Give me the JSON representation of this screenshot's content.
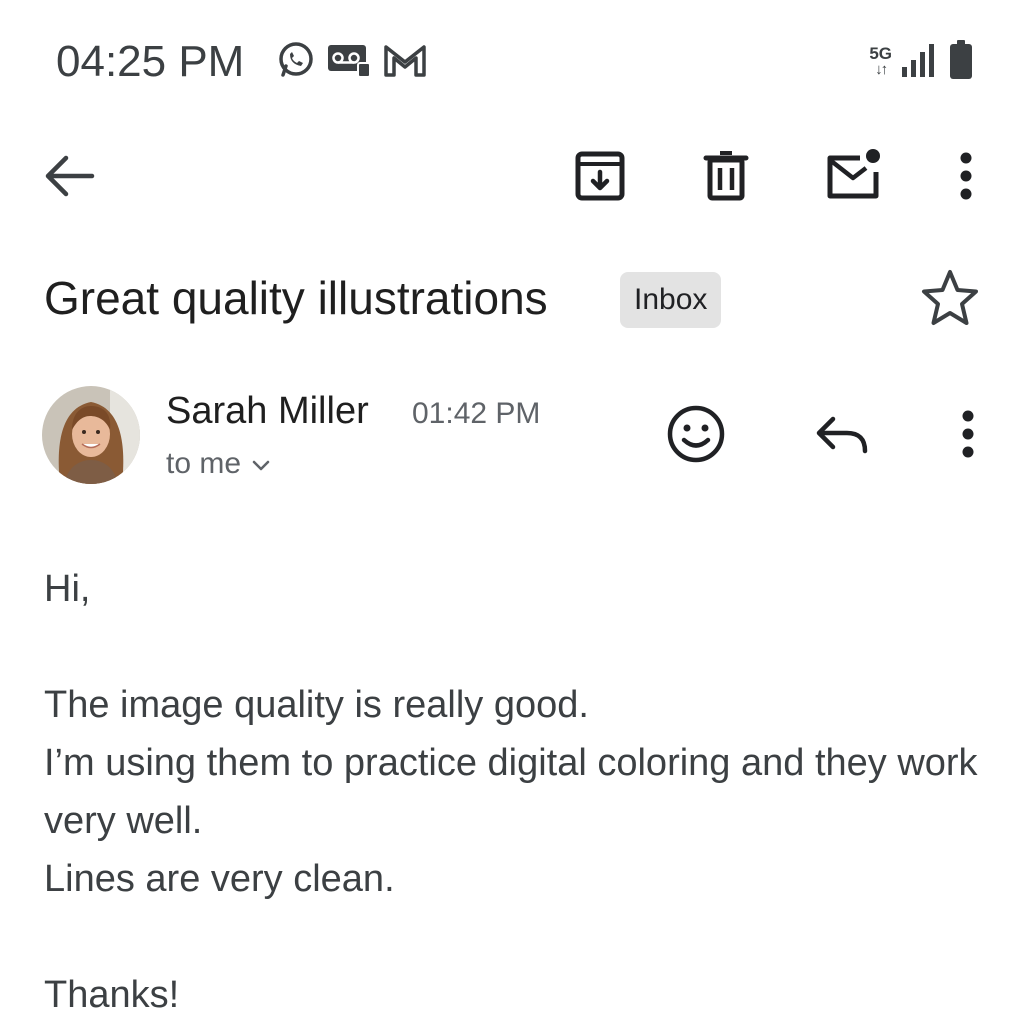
{
  "status_bar": {
    "time": "04:25 PM",
    "network": "5G",
    "network_arrows": "↓↑",
    "notification_icons": [
      "whatsapp-icon",
      "voicemail-icon",
      "gmail-icon"
    ]
  },
  "toolbar": {
    "back_icon": "arrow-left-icon",
    "archive_icon": "archive-icon",
    "delete_icon": "trash-icon",
    "mark_unread_icon": "mail-unread-icon",
    "more_icon": "more-vert-icon"
  },
  "email": {
    "subject": "Great quality illustrations",
    "label": "Inbox",
    "sender": {
      "name": "Sarah Miller",
      "time": "01:42 PM",
      "recipient": "to me"
    },
    "body": {
      "greeting": "Hi,",
      "lines": [
        "The image quality is really good.",
        "I’m using them to practice digital coloring and they work very well.",
        "Lines are very clean."
      ],
      "signoff": "Thanks!"
    }
  },
  "colors": {
    "icon": "#3c4043",
    "chip_bg": "#e3e3e3",
    "secondary_text": "#5f6368"
  }
}
